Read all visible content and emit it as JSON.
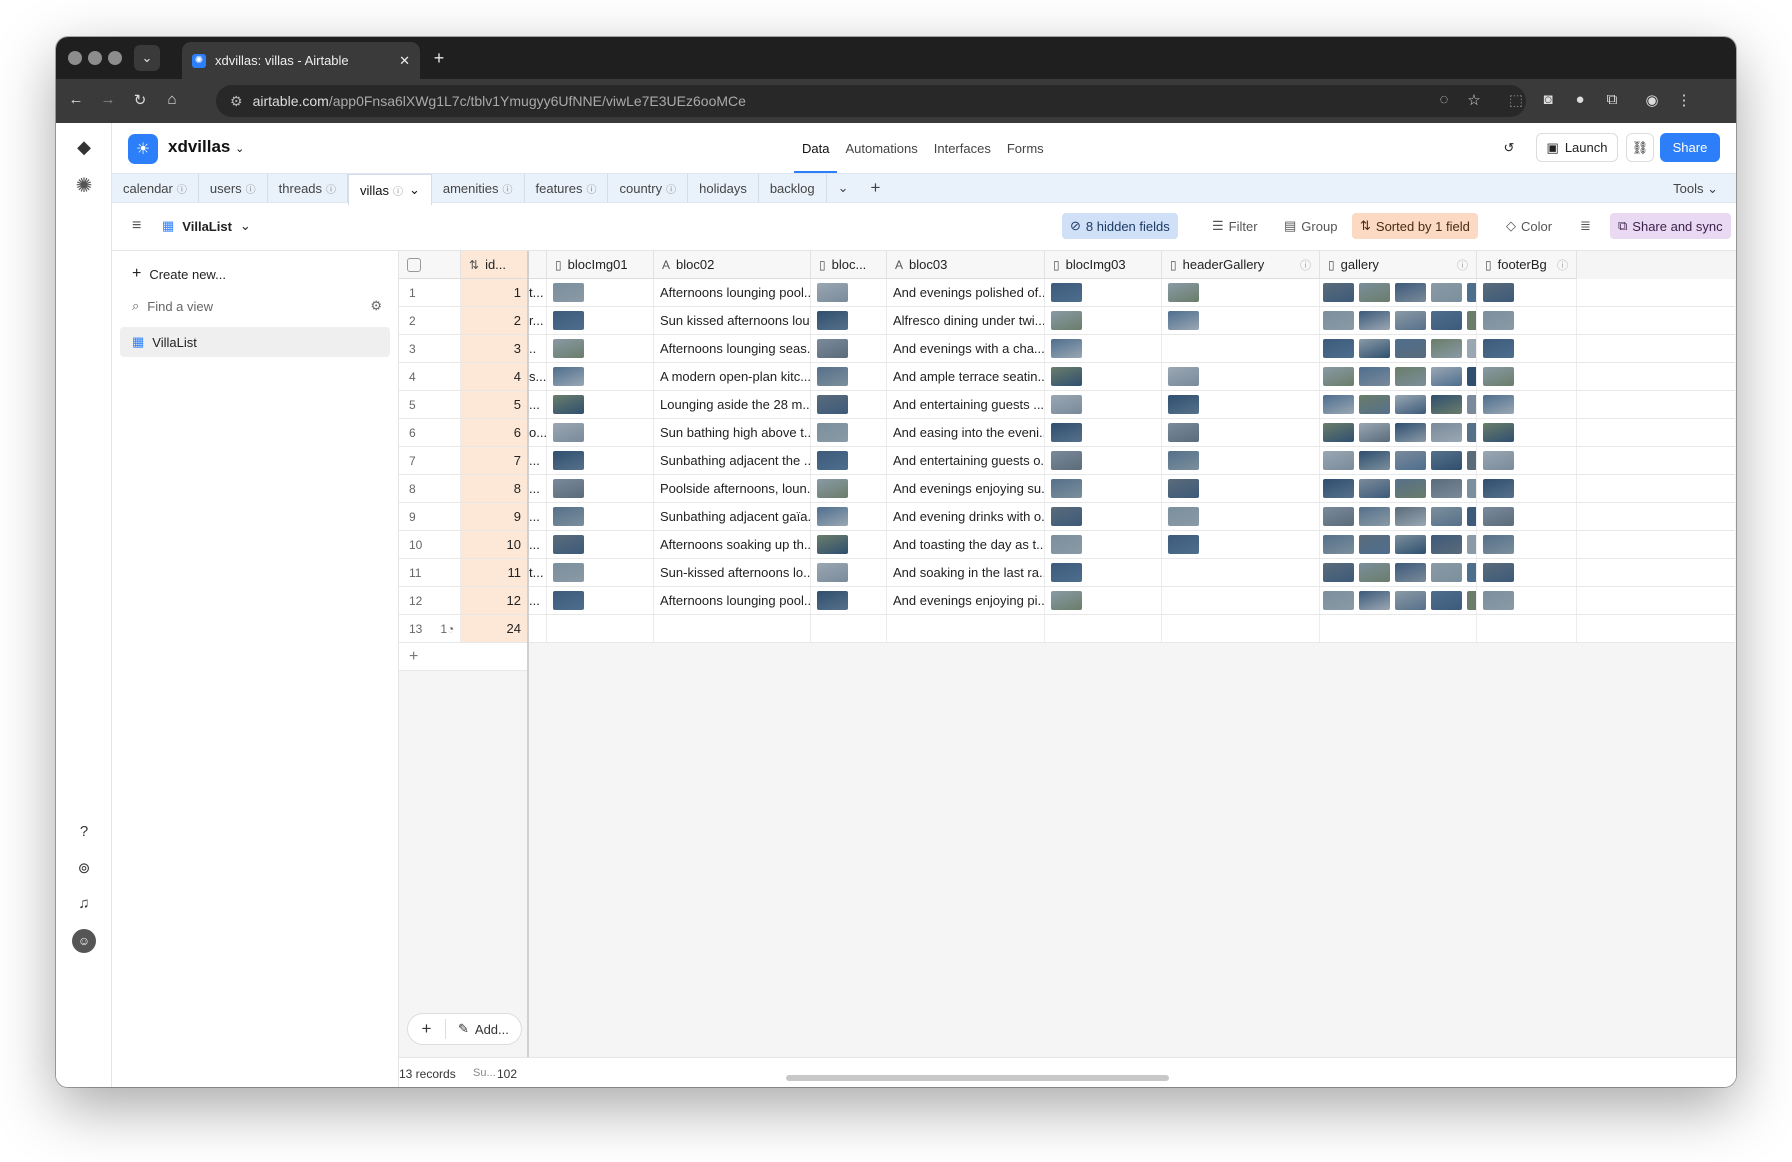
{
  "browser": {
    "tab_title": "xdvillas: villas - Airtable",
    "url_host": "airtable.com",
    "url_path": "/app0Fnsa6lXWg1L7c/tblv1Ymugyy6UfNNE/viwLe7E3UEz6ooMCe"
  },
  "header": {
    "base_name": "xdvillas",
    "nav": [
      "Data",
      "Automations",
      "Interfaces",
      "Forms"
    ],
    "launch_label": "Launch",
    "share_label": "Share"
  },
  "tables": [
    {
      "label": "calendar",
      "info": true
    },
    {
      "label": "users",
      "info": true
    },
    {
      "label": "threads",
      "info": true
    },
    {
      "label": "villas",
      "info": true,
      "active": true
    },
    {
      "label": "amenities",
      "info": true
    },
    {
      "label": "features",
      "info": true
    },
    {
      "label": "country",
      "info": true
    },
    {
      "label": "holidays",
      "info": false
    },
    {
      "label": "backlog",
      "info": false
    }
  ],
  "tools_label": "Tools",
  "viewbar": {
    "view_name": "VillaList",
    "hidden_fields": "8 hidden fields",
    "filter": "Filter",
    "group": "Group",
    "sort": "Sorted by 1 field",
    "color": "Color",
    "share_sync": "Share and sync"
  },
  "sidebar": {
    "create_new": "Create new...",
    "find_view": "Find a view",
    "views": [
      "VillaList"
    ]
  },
  "columns": [
    "id...",
    "blocImg01",
    "bloc02",
    "bloc...",
    "bloc03",
    "blocImg03",
    "headerGallery",
    "gallery",
    "footerBg"
  ],
  "rows": [
    {
      "n": "1",
      "id": "1",
      "t": "t...",
      "b02": "Afternoons lounging pool...",
      "b03": "And evenings polished of...",
      "h": 1,
      "g": 7
    },
    {
      "n": "2",
      "id": "2",
      "t": "r...",
      "b02": "Sun kissed afternoons lou...",
      "b03": "Alfresco dining under twi...",
      "h": 1,
      "g": 7
    },
    {
      "n": "3",
      "id": "3",
      "t": "..",
      "b02": "Afternoons lounging seas...",
      "b03": "And evenings with a cha...",
      "h": 0,
      "g": 7
    },
    {
      "n": "4",
      "id": "4",
      "t": "s...",
      "b02": "A modern open-plan kitc...",
      "b03": "And ample terrace seatin...",
      "h": 1,
      "g": 7
    },
    {
      "n": "5",
      "id": "5",
      "t": "...",
      "b02": "Lounging aside the 28 m...",
      "b03": "And entertaining guests ...",
      "h": 1,
      "g": 7
    },
    {
      "n": "6",
      "id": "6",
      "t": "o...",
      "b02": "Sun bathing high above t...",
      "b03": "And easing into the eveni...",
      "h": 1,
      "g": 7
    },
    {
      "n": "7",
      "id": "7",
      "t": "...",
      "b02": "Sunbathing adjacent the ...",
      "b03": "And entertaining guests o...",
      "h": 1,
      "g": 7
    },
    {
      "n": "8",
      "id": "8",
      "t": "...",
      "b02": "Poolside afternoons, loun...",
      "b03": "And evenings enjoying su...",
      "h": 1,
      "g": 7
    },
    {
      "n": "9",
      "id": "9",
      "t": "...",
      "b02": "Sunbathing adjacent gaïa...",
      "b03": "And evening drinks with o...",
      "h": 1,
      "g": 7
    },
    {
      "n": "10",
      "id": "10",
      "t": "...",
      "b02": "Afternoons soaking up th...",
      "b03": "And toasting the day as t...",
      "h": 1,
      "g": 7
    },
    {
      "n": "11",
      "id": "11",
      "t": "t...",
      "b02": "Sun-kissed afternoons lo...",
      "b03": "And soaking in the last ra...",
      "h": 0,
      "g": 7
    },
    {
      "n": "12",
      "id": "12",
      "t": "...",
      "b02": "Afternoons lounging pool...",
      "b03": "And evenings enjoying pi...",
      "h": 0,
      "g": 7
    }
  ],
  "row13": {
    "n": "13",
    "comments": "1",
    "id": "24"
  },
  "footer": {
    "records": "13 records",
    "sum_label": "Su...",
    "sum_value": "102",
    "add_label": "Add..."
  },
  "colors": {
    "accent": "#2d7ff9",
    "sorted_col": "#fde8d7",
    "hidden_bg": "#cfe0f7",
    "sort_bg": "#fbd9c3",
    "share_bg": "#ead9f2"
  }
}
